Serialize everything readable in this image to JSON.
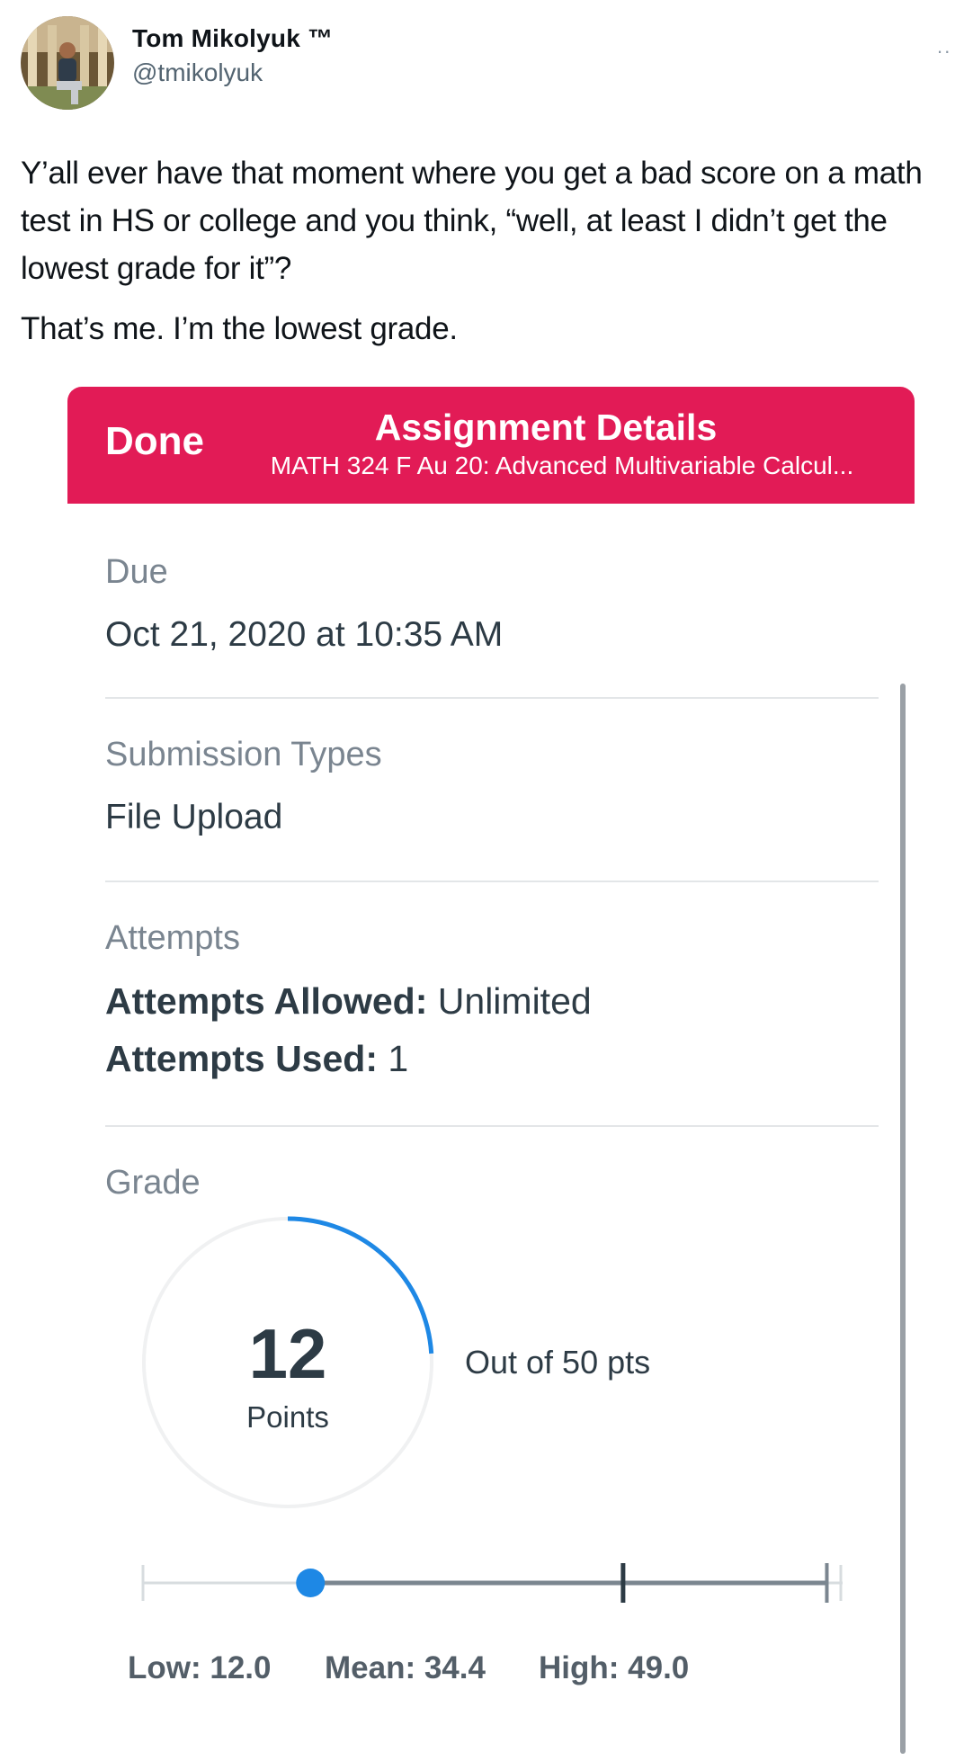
{
  "tweet": {
    "author_name": "Tom Mikolyuk ™",
    "author_handle": "@tmikolyuk",
    "more_icon": "more-icon",
    "paragraphs": [
      "Y’all ever have that moment where you get a bad score on a math test in HS or college and you think, “well, at least I didn’t get the lowest grade for it”?",
      "That’s me. I’m the lowest grade."
    ]
  },
  "assignment": {
    "nav": {
      "done_label": "Done",
      "title": "Assignment Details",
      "subtitle": "MATH 324 F Au 20: Advanced Multivariable Calcul..."
    },
    "due": {
      "label": "Due",
      "value": "Oct 21, 2020 at 10:35 AM"
    },
    "submission": {
      "label": "Submission Types",
      "value": "File Upload"
    },
    "attempts": {
      "label": "Attempts",
      "allowed_label": "Attempts Allowed:",
      "allowed_value": "Unlimited",
      "used_label": "Attempts Used:",
      "used_value": "1"
    },
    "grade": {
      "label": "Grade",
      "points": "12",
      "points_label": "Points",
      "out_of": "Out of 50 pts",
      "score": 12,
      "max": 50,
      "low_text": "Low: 12.0",
      "mean_text": "Mean: 34.4",
      "high_text": "High: 49.0",
      "low": 12.0,
      "mean": 34.4,
      "high": 49.0
    },
    "colors": {
      "brand": "#e21b56",
      "progress": "#1e88e5",
      "text": "#2d3b45",
      "muted": "#7a8590"
    }
  }
}
